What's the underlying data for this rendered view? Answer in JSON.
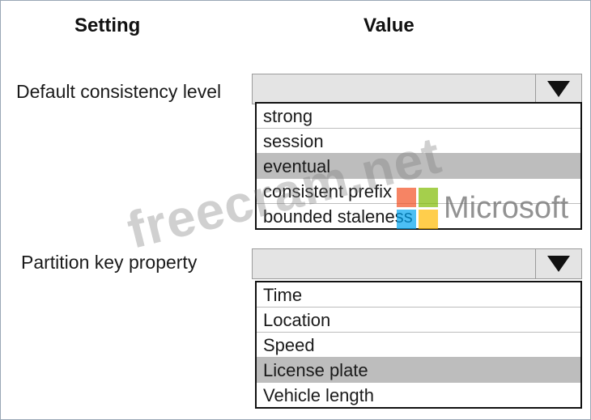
{
  "headers": {
    "setting": "Setting",
    "value": "Value"
  },
  "rows": [
    {
      "label": "Default consistency level",
      "selected_value": "",
      "options": [
        "strong",
        "session",
        "eventual",
        "consistent prefix",
        "bounded staleness"
      ],
      "highlighted_option": "eventual"
    },
    {
      "label": "Partition key property",
      "selected_value": "",
      "options": [
        "Time",
        "Location",
        "Speed",
        "License plate",
        "Vehicle length"
      ],
      "highlighted_option": "License plate"
    }
  ],
  "watermark": {
    "site": "freecram.net",
    "brand": "Microsoft"
  },
  "colors": {
    "highlight": "#bdbdbd",
    "combo_bg": "#e4e4e4",
    "ms_red": "#f25022",
    "ms_green": "#7fba00",
    "ms_blue": "#00a4ef",
    "ms_yellow": "#ffb900"
  },
  "icons": {
    "dropdown_arrow": "triangle-down-icon",
    "brand_logo": "microsoft-logo"
  }
}
